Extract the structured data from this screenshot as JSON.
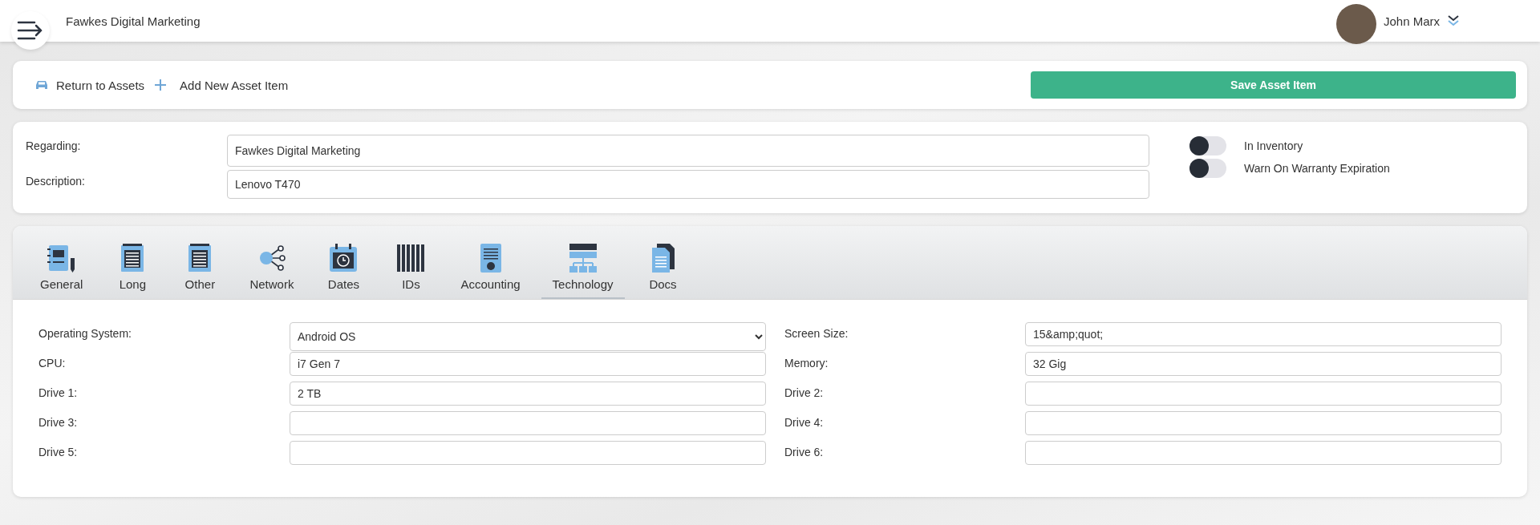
{
  "header": {
    "company": "Fawkes Digital Marketing",
    "user": "John Marx"
  },
  "actions": {
    "return": "Return to Assets",
    "add": "Add New Asset Item",
    "save": "Save Asset Item"
  },
  "details": {
    "fields": [
      {
        "label": "Regarding:",
        "value": "Fawkes Digital Marketing"
      },
      {
        "label": "Description:",
        "value": "Lenovo T470"
      }
    ],
    "toggles": [
      {
        "label": "In Inventory",
        "on": false
      },
      {
        "label": "Warn On Warranty Expiration",
        "on": false
      }
    ]
  },
  "tabs": [
    {
      "label": "General",
      "kind": "general",
      "selected": false
    },
    {
      "label": "Long",
      "kind": "notepad",
      "selected": false
    },
    {
      "label": "Other",
      "kind": "notepad",
      "selected": false
    },
    {
      "label": "Network",
      "kind": "network",
      "selected": false
    },
    {
      "label": "Dates",
      "kind": "calendar",
      "selected": false
    },
    {
      "label": "IDs",
      "kind": "barcode",
      "selected": false
    },
    {
      "label": "Accounting",
      "kind": "invoice",
      "selected": false
    },
    {
      "label": "Technology",
      "kind": "server",
      "selected": true
    },
    {
      "label": "Docs",
      "kind": "docs",
      "selected": false
    }
  ],
  "technology": [
    {
      "label": "Operating System:",
      "value": "Android OS",
      "kind": "select"
    },
    {
      "label": "Screen Size:",
      "value": "15&amp;quot;",
      "kind": "text"
    },
    {
      "label": "CPU:",
      "value": "i7 Gen 7",
      "kind": "text"
    },
    {
      "label": "Memory:",
      "value": "32 Gig",
      "kind": "text"
    },
    {
      "label": "Drive 1:",
      "value": "2 TB",
      "kind": "text"
    },
    {
      "label": "Drive 2:",
      "kind": "text"
    },
    {
      "label": "Drive 3:",
      "kind": "text"
    },
    {
      "label": "Drive 4:",
      "kind": "text"
    },
    {
      "label": "Drive 5:",
      "kind": "text"
    },
    {
      "label": "Drive 6:",
      "kind": "text"
    }
  ]
}
